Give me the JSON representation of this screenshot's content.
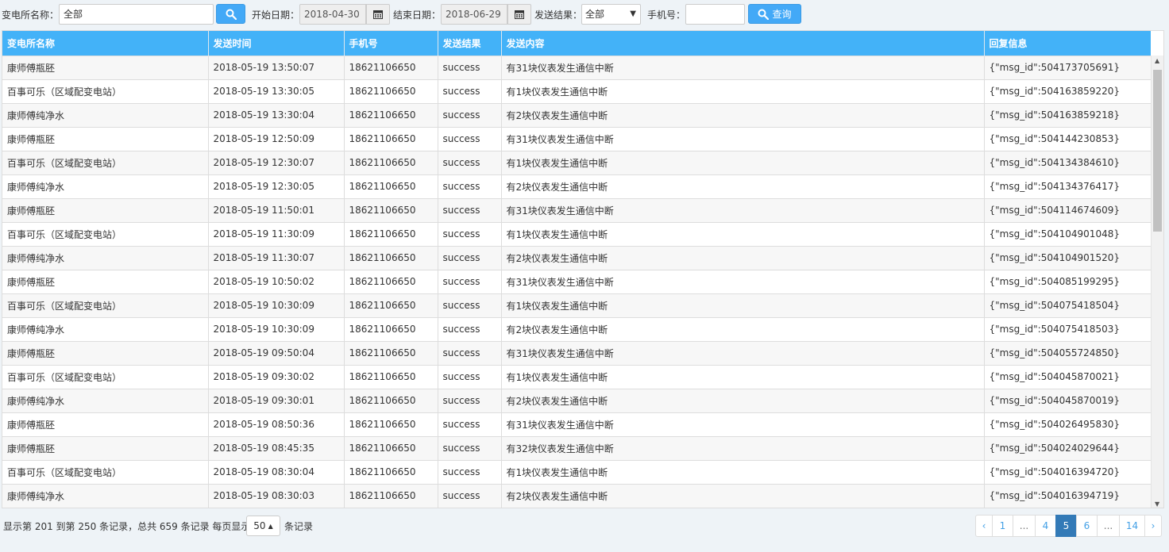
{
  "filters": {
    "station_label": "变电所名称：",
    "station_value": "全部",
    "start_label": "开始日期：",
    "start_value": "2018-04-30",
    "end_label": "结束日期：",
    "end_value": "2018-06-29",
    "result_label": "发送结果：",
    "result_value": "全部",
    "phone_label": "手机号：",
    "phone_value": "",
    "query_label": "查询"
  },
  "table": {
    "columns": [
      "变电所名称",
      "发送时间",
      "手机号",
      "发送结果",
      "发送内容",
      "回复信息"
    ],
    "rows": [
      [
        "康师傅瓶胚",
        "2018-05-19 13:50:07",
        "18621106650",
        "success",
        "有31块仪表发生通信中断",
        "{\"msg_id\":504173705691}"
      ],
      [
        "百事可乐（区域配变电站）",
        "2018-05-19 13:30:05",
        "18621106650",
        "success",
        "有1块仪表发生通信中断",
        "{\"msg_id\":504163859220}"
      ],
      [
        "康师傅纯净水",
        "2018-05-19 13:30:04",
        "18621106650",
        "success",
        "有2块仪表发生通信中断",
        "{\"msg_id\":504163859218}"
      ],
      [
        "康师傅瓶胚",
        "2018-05-19 12:50:09",
        "18621106650",
        "success",
        "有31块仪表发生通信中断",
        "{\"msg_id\":504144230853}"
      ],
      [
        "百事可乐（区域配变电站）",
        "2018-05-19 12:30:07",
        "18621106650",
        "success",
        "有1块仪表发生通信中断",
        "{\"msg_id\":504134384610}"
      ],
      [
        "康师傅纯净水",
        "2018-05-19 12:30:05",
        "18621106650",
        "success",
        "有2块仪表发生通信中断",
        "{\"msg_id\":504134376417}"
      ],
      [
        "康师傅瓶胚",
        "2018-05-19 11:50:01",
        "18621106650",
        "success",
        "有31块仪表发生通信中断",
        "{\"msg_id\":504114674609}"
      ],
      [
        "百事可乐（区域配变电站）",
        "2018-05-19 11:30:09",
        "18621106650",
        "success",
        "有1块仪表发生通信中断",
        "{\"msg_id\":504104901048}"
      ],
      [
        "康师傅纯净水",
        "2018-05-19 11:30:07",
        "18621106650",
        "success",
        "有2块仪表发生通信中断",
        "{\"msg_id\":504104901520}"
      ],
      [
        "康师傅瓶胚",
        "2018-05-19 10:50:02",
        "18621106650",
        "success",
        "有31块仪表发生通信中断",
        "{\"msg_id\":504085199295}"
      ],
      [
        "百事可乐（区域配变电站）",
        "2018-05-19 10:30:09",
        "18621106650",
        "success",
        "有1块仪表发生通信中断",
        "{\"msg_id\":504075418504}"
      ],
      [
        "康师傅纯净水",
        "2018-05-19 10:30:09",
        "18621106650",
        "success",
        "有2块仪表发生通信中断",
        "{\"msg_id\":504075418503}"
      ],
      [
        "康师傅瓶胚",
        "2018-05-19 09:50:04",
        "18621106650",
        "success",
        "有31块仪表发生通信中断",
        "{\"msg_id\":504055724850}"
      ],
      [
        "百事可乐（区域配变电站）",
        "2018-05-19 09:30:02",
        "18621106650",
        "success",
        "有1块仪表发生通信中断",
        "{\"msg_id\":504045870021}"
      ],
      [
        "康师傅纯净水",
        "2018-05-19 09:30:01",
        "18621106650",
        "success",
        "有2块仪表发生通信中断",
        "{\"msg_id\":504045870019}"
      ],
      [
        "康师傅瓶胚",
        "2018-05-19 08:50:36",
        "18621106650",
        "success",
        "有31块仪表发生通信中断",
        "{\"msg_id\":504026495830}"
      ],
      [
        "康师傅瓶胚",
        "2018-05-19 08:45:35",
        "18621106650",
        "success",
        "有32块仪表发生通信中断",
        "{\"msg_id\":504024029644}"
      ],
      [
        "百事可乐（区域配变电站）",
        "2018-05-19 08:30:04",
        "18621106650",
        "success",
        "有1块仪表发生通信中断",
        "{\"msg_id\":504016394720}"
      ],
      [
        "康师傅纯净水",
        "2018-05-19 08:30:03",
        "18621106650",
        "success",
        "有2块仪表发生通信中断",
        "{\"msg_id\":504016394719}"
      ]
    ]
  },
  "footer": {
    "info": "显示第 201 到第 250 条记录，总共 659 条记录 每页显示",
    "page_size": "50",
    "tail": "条记录"
  },
  "pagination": {
    "pages": [
      "‹",
      "1",
      "...",
      "4",
      "5",
      "6",
      "...",
      "14",
      "›"
    ],
    "active": "5"
  },
  "colors": {
    "header_bg": "#43b2f8",
    "button_bg": "#43a9f7",
    "active_page": "#337ab7"
  }
}
